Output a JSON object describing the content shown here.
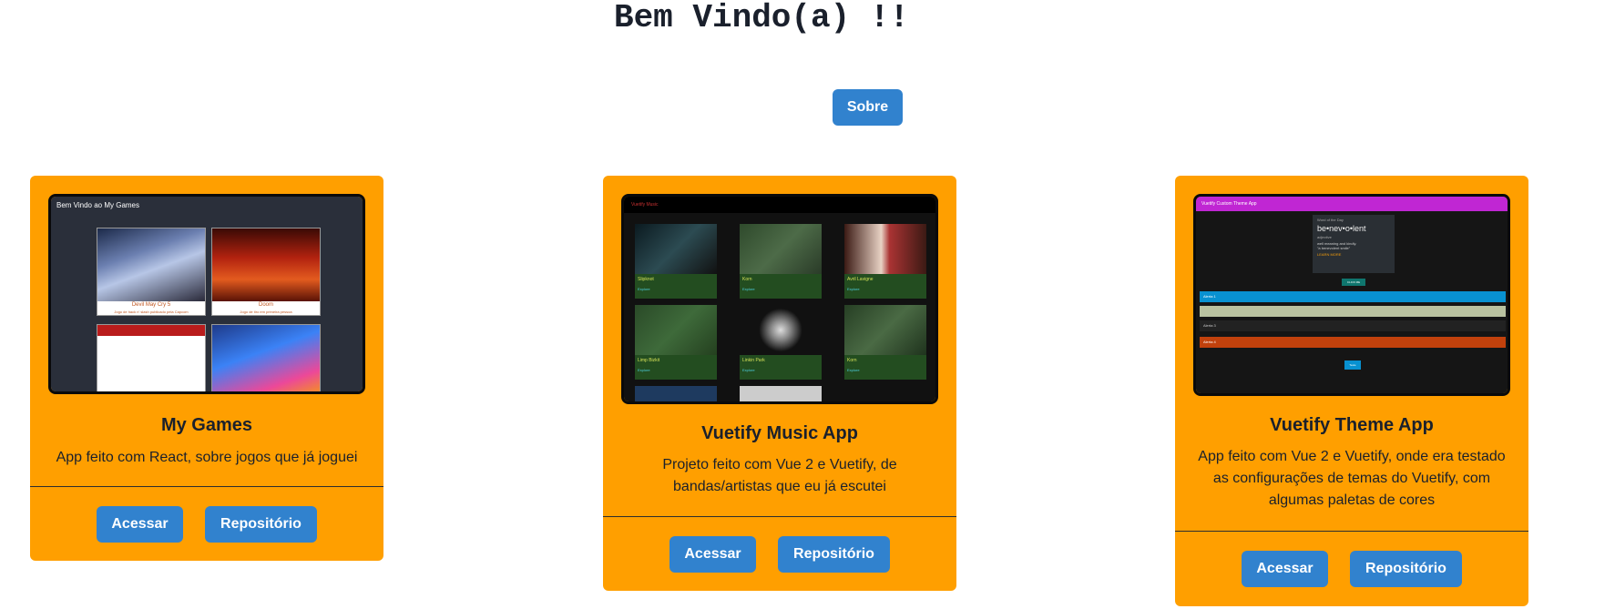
{
  "header": {
    "title": "Bem Vindo(a) !!"
  },
  "about_button": "Sobre",
  "colors": {
    "card_bg": "#ff9f00",
    "button": "#3182ce"
  },
  "cards": [
    {
      "title": "My Games",
      "description": "App feito com React, sobre jogos que já joguei",
      "access_label": "Acessar",
      "repo_label": "Repositório",
      "preview": {
        "heading": "Bem Vindo ao My Games",
        "tiles": [
          {
            "name": "Devil May Cry 5",
            "sub": "Jogo de hack n' slash publicado pela Capcom"
          },
          {
            "name": "Doom",
            "sub": "Jogo de tiro em primeira pessoa"
          }
        ]
      }
    },
    {
      "title": "Vuetify Music App",
      "description": "Projeto feito com Vue 2 e Vuetify, de bandas/artistas que eu já escutei",
      "access_label": "Acessar",
      "repo_label": "Repositório",
      "preview": {
        "heading": "Vuetify Music",
        "tiles": [
          "Slipknot",
          "Korn",
          "Avril Lavigne",
          "Limp Bizkit",
          "Linkin Park",
          "Korn"
        ],
        "link": "Explore"
      }
    },
    {
      "title": "Vuetify Theme App",
      "description": "App feito com Vue 2 e Vuetify, onde era testado as configurações de temas do Vuetify, com algumas paletas de cores",
      "access_label": "Acessar",
      "repo_label": "Repositório",
      "preview": {
        "heading": "Vuetify Custom Theme App",
        "word_label": "Word of the Day",
        "word": "be•nev•o•lent",
        "pos": "adjective",
        "definition": "well meaning and kindly.",
        "quote": "\"a benevolent smile\"",
        "learn": "LEARN MORE",
        "button": "CLICK ME",
        "alerts": [
          "Alerta 1",
          "Alerta 2",
          "Alerta 3",
          "Alerta 4"
        ],
        "bottom_button": "Teste"
      }
    }
  ]
}
